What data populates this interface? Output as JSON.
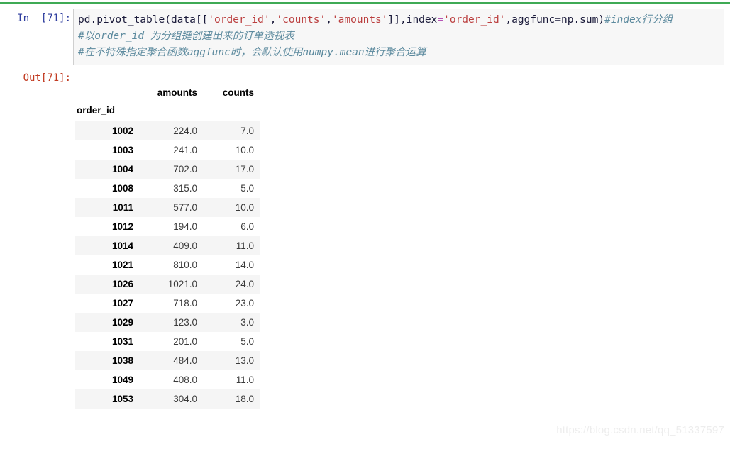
{
  "notebook": {
    "in_prompt": "In  [71]:",
    "out_prompt": "Out[71]:",
    "execution_count": "71",
    "colors": {
      "top_rule": "#3faa55",
      "cell_background": "#f7f7f7",
      "cell_border": "#cfcfcf",
      "in_prompt": "#303f9f",
      "out_prompt": "#c23b22",
      "string_token": "#bb3f3f",
      "operator_token": "#a020a0",
      "comment_token": "#5c8a9e",
      "row_stripe": "#f5f5f5"
    }
  },
  "code": {
    "line1": {
      "t1": "pd.pivot_table(data[[",
      "s1": "'order_id'",
      "t2": ",",
      "s2": "'counts'",
      "t3": ",",
      "s3": "'amounts'",
      "t4": "]],index",
      "op1": "=",
      "s4": "'order_id'",
      "t5": ",aggfunc=np.sum)",
      "comment": "#index行分组"
    },
    "line2": "#以order_id 为分组键创建出来的订单透视表",
    "line3": "#在不特殊指定聚合函数aggfunc时，会默认使用numpy.mean进行聚合运算"
  },
  "table": {
    "index_name": "order_id",
    "columns": [
      "amounts",
      "counts"
    ],
    "rows": [
      {
        "index": "1002",
        "amounts": "224.0",
        "counts": "7.0"
      },
      {
        "index": "1003",
        "amounts": "241.0",
        "counts": "10.0"
      },
      {
        "index": "1004",
        "amounts": "702.0",
        "counts": "17.0"
      },
      {
        "index": "1008",
        "amounts": "315.0",
        "counts": "5.0"
      },
      {
        "index": "1011",
        "amounts": "577.0",
        "counts": "10.0"
      },
      {
        "index": "1012",
        "amounts": "194.0",
        "counts": "6.0"
      },
      {
        "index": "1014",
        "amounts": "409.0",
        "counts": "11.0"
      },
      {
        "index": "1021",
        "amounts": "810.0",
        "counts": "14.0"
      },
      {
        "index": "1026",
        "amounts": "1021.0",
        "counts": "24.0"
      },
      {
        "index": "1027",
        "amounts": "718.0",
        "counts": "23.0"
      },
      {
        "index": "1029",
        "amounts": "123.0",
        "counts": "3.0"
      },
      {
        "index": "1031",
        "amounts": "201.0",
        "counts": "5.0"
      },
      {
        "index": "1038",
        "amounts": "484.0",
        "counts": "13.0"
      },
      {
        "index": "1049",
        "amounts": "408.0",
        "counts": "11.0"
      },
      {
        "index": "1053",
        "amounts": "304.0",
        "counts": "18.0"
      }
    ]
  },
  "watermark": {
    "text": "https://blog.csdn.net/qq_51337597"
  }
}
